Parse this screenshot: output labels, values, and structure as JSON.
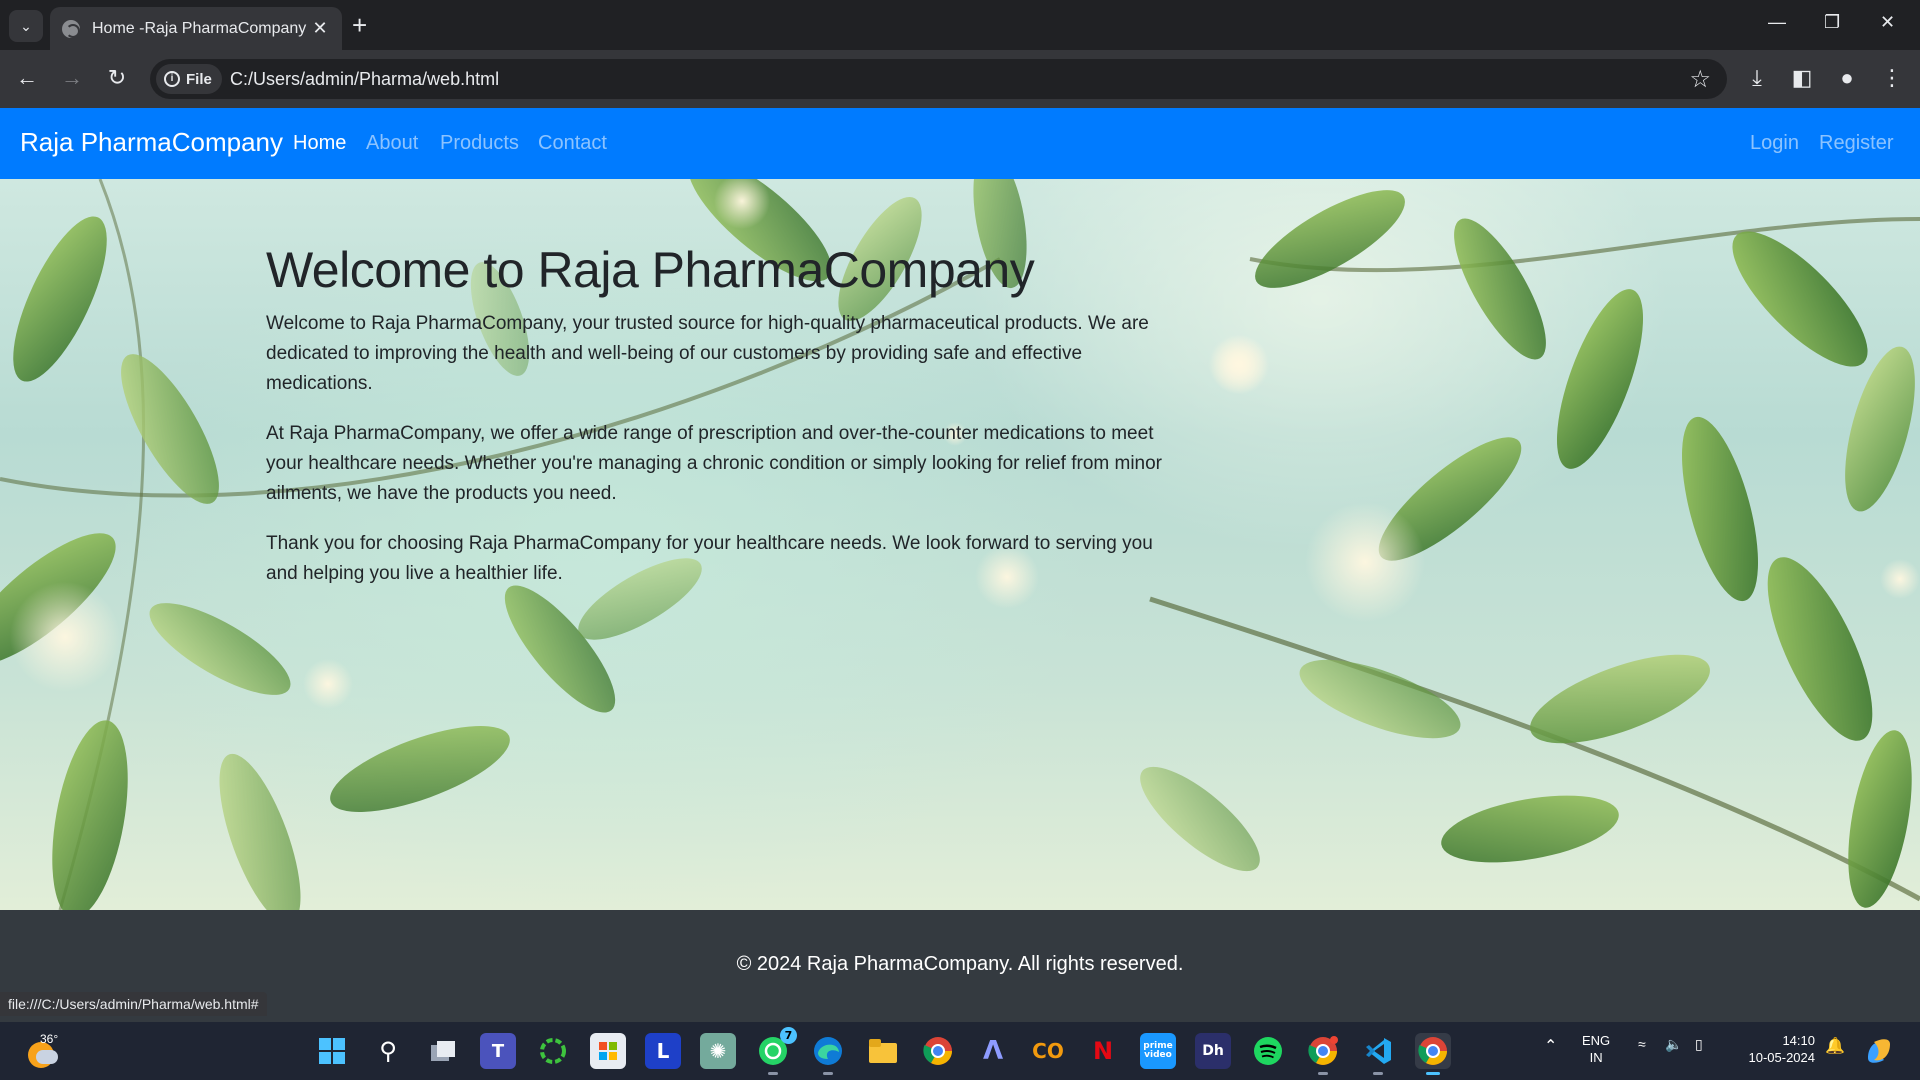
{
  "browser": {
    "tab_title": "Home -Raja PharmaCompany",
    "new_tab_label": "+",
    "chip_label": "File",
    "url": "C:/Users/admin/Pharma/web.html",
    "status_url": "file:///C:/Users/admin/Pharma/web.html#"
  },
  "navbar": {
    "brand": "Raja PharmaCompany",
    "links": [
      "Home",
      "About",
      "Products",
      "Contact"
    ],
    "active_link": "Home",
    "right_links": [
      "Login",
      "Register"
    ]
  },
  "hero": {
    "title": "Welcome to Raja PharmaCompany",
    "paragraphs": [
      "Welcome to Raja PharmaCompany, your trusted source for high-quality pharmaceutical products. We are dedicated to improving the health and well-being of our customers by providing safe and effective medications.",
      "At Raja PharmaCompany, we offer a wide range of prescription and over-the-counter medications to meet your healthcare needs. Whether you're managing a chronic condition or simply looking for relief from minor ailments, we have the products you need.",
      "Thank you for choosing Raja PharmaCompany for your healthcare needs. We look forward to serving you and helping you live a healthier life."
    ]
  },
  "footer": {
    "text": "© 2024 Raja PharmaCompany. All rights reserved."
  },
  "taskbar": {
    "weather_temp": "36°",
    "whatsapp_badge": "7",
    "apps": [
      "start-icon",
      "search-icon",
      "task-view-icon",
      "teams-icon",
      "circle-app-icon",
      "store-icon",
      "l-app-icon",
      "chatgpt-icon",
      "whatsapp-icon",
      "edge-icon",
      "file-explorer-icon",
      "chrome-icon",
      "arc-icon",
      "co-app-icon",
      "netflix-icon",
      "prime-video-icon",
      "dh-app-icon",
      "spotify-icon",
      "chrome-profile-icon",
      "vscode-icon",
      "chrome-active-icon"
    ],
    "lang_line1": "ENG",
    "lang_line2": "IN",
    "time": "14:10",
    "date": "10-05-2024"
  },
  "colors": {
    "navbar_bg": "#007bff",
    "footer_bg": "#343a40",
    "chrome_dark": "#202124",
    "chrome_toolbar": "#35363a",
    "taskbar_bg": "#1f2533"
  }
}
